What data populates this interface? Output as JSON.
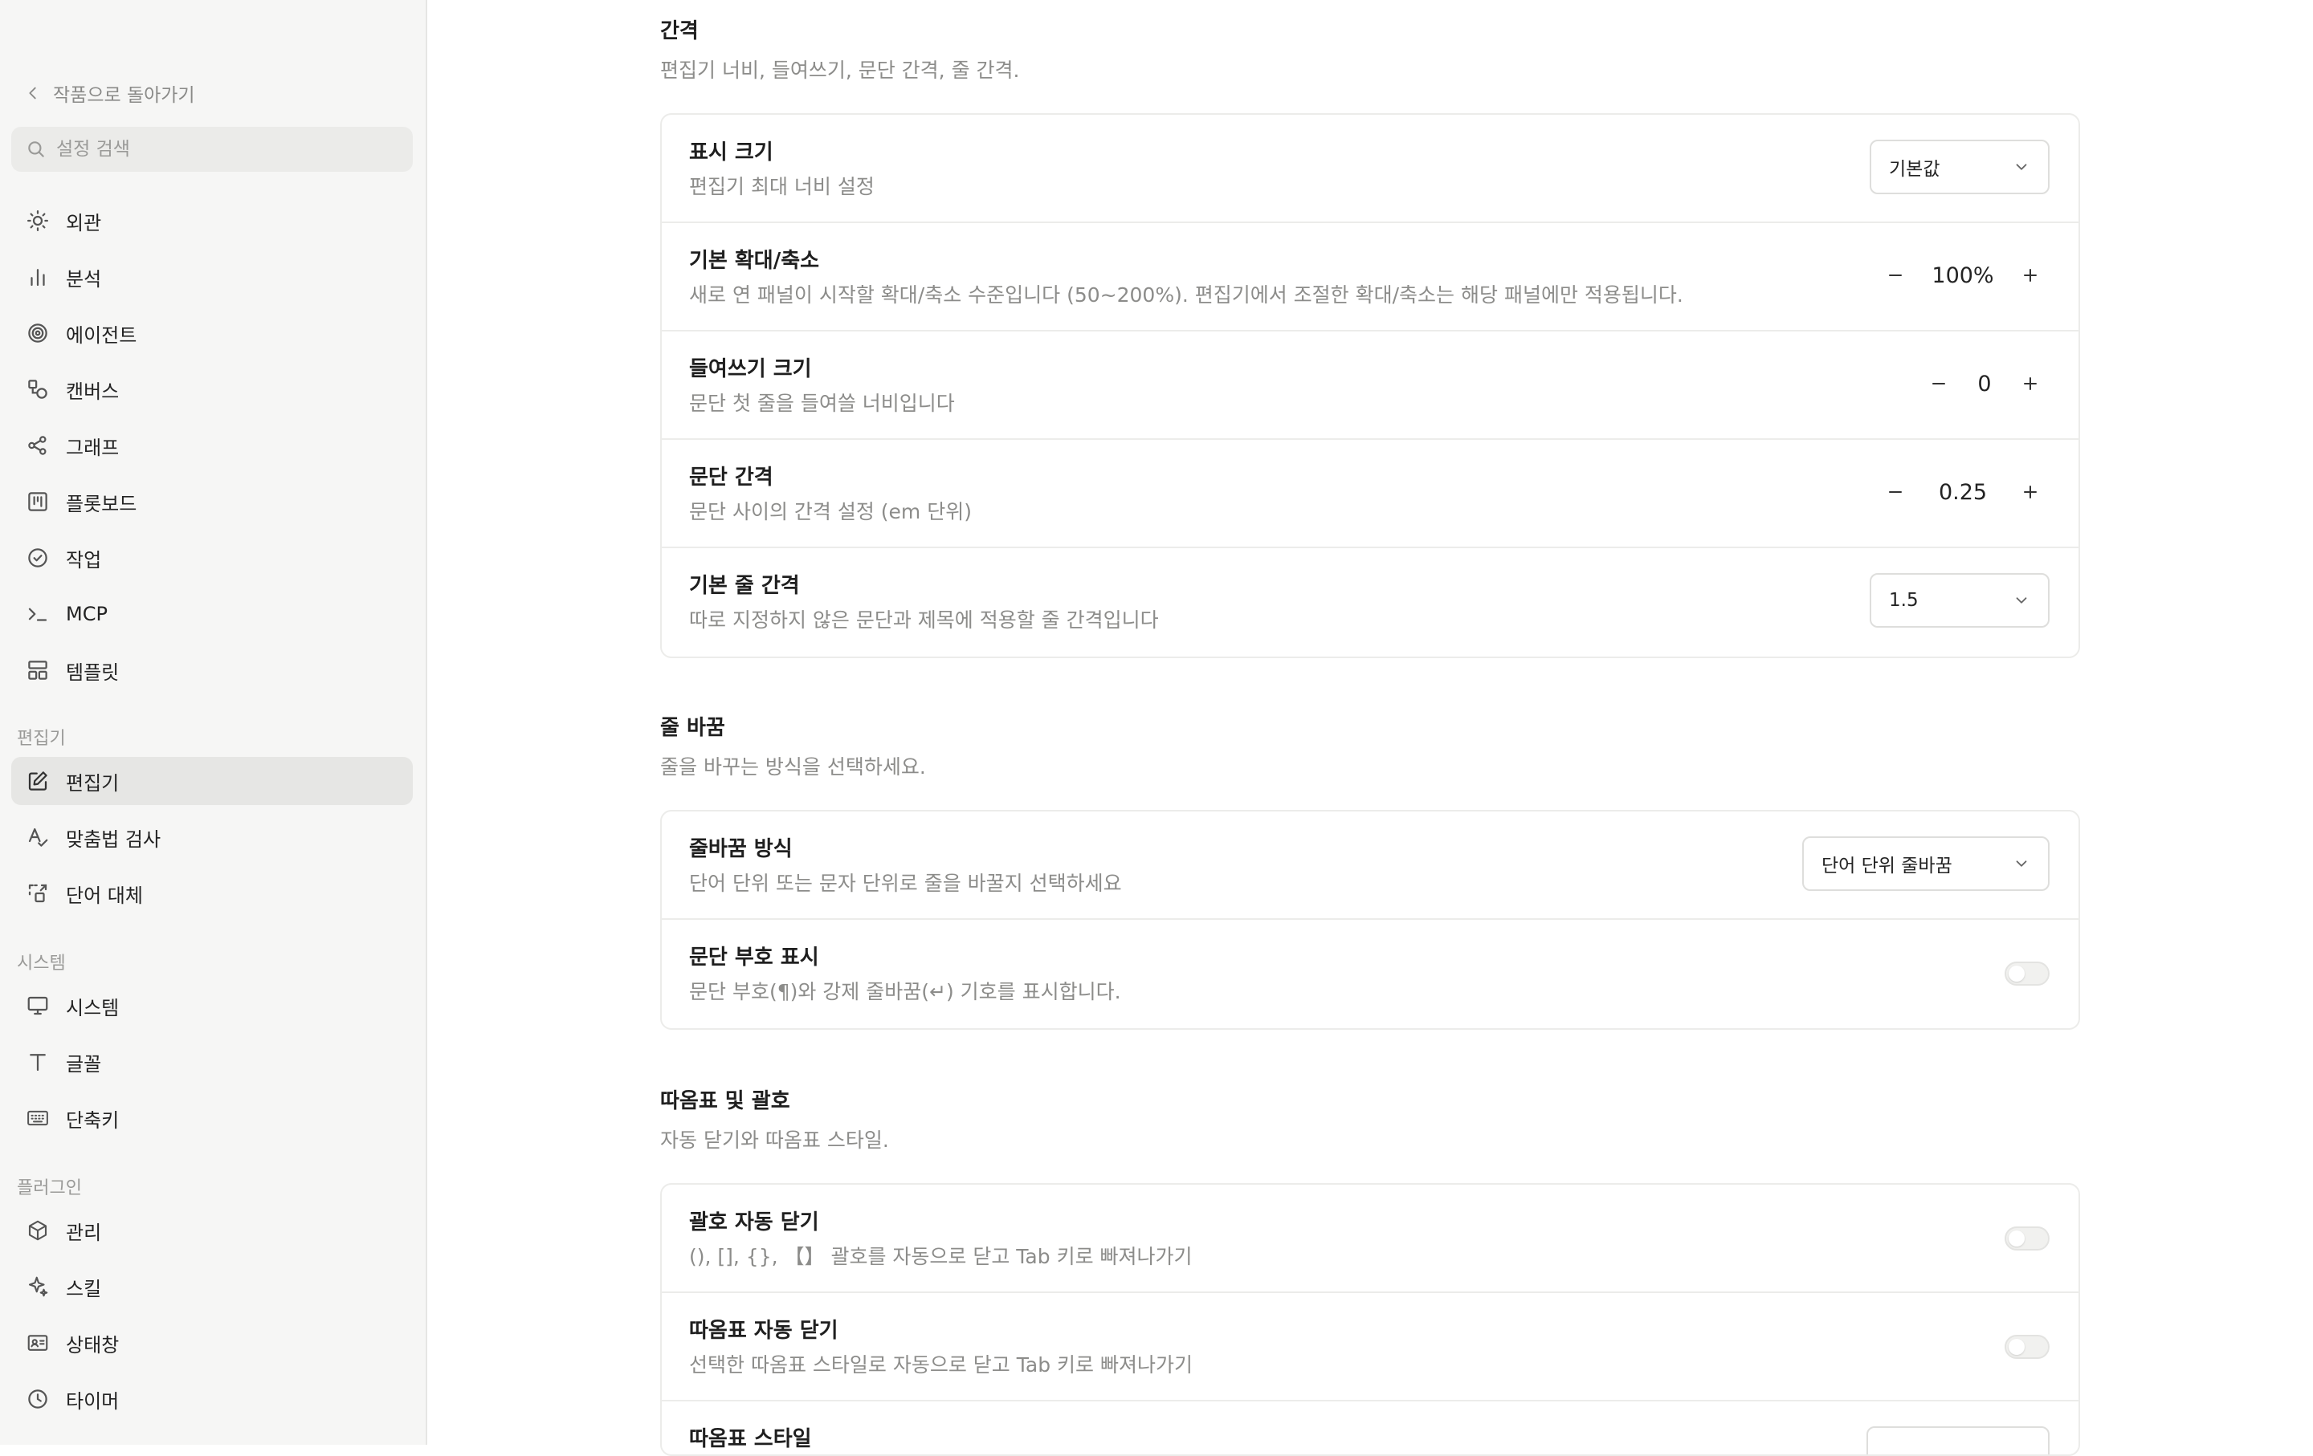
{
  "sidebar": {
    "back_label": "작품으로 돌아가기",
    "search_placeholder": "설정 검색",
    "items": [
      {
        "label": "외관"
      },
      {
        "label": "분석"
      },
      {
        "label": "에이전트"
      },
      {
        "label": "캔버스"
      },
      {
        "label": "그래프"
      },
      {
        "label": "플롯보드"
      },
      {
        "label": "작업"
      },
      {
        "label": "MCP"
      },
      {
        "label": "템플릿"
      }
    ],
    "editor_section": {
      "label": "편집기",
      "items": [
        {
          "label": "편집기"
        },
        {
          "label": "맞춤법 검사"
        },
        {
          "label": "단어 대체"
        }
      ]
    },
    "system_section": {
      "label": "시스템",
      "items": [
        {
          "label": "시스템"
        },
        {
          "label": "글꼴"
        },
        {
          "label": "단축키"
        }
      ]
    },
    "plugin_section": {
      "label": "플러그인",
      "items": [
        {
          "label": "관리"
        },
        {
          "label": "스킬"
        },
        {
          "label": "상태창"
        },
        {
          "label": "타이머"
        }
      ]
    }
  },
  "spacing": {
    "title": "간격",
    "desc": "편집기 너비, 들여쓰기, 문단 간격, 줄 간격.",
    "display_size": {
      "title": "표시 크기",
      "desc": "편집기 최대 너비 설정",
      "value": "기본값"
    },
    "zoom": {
      "title": "기본 확대/축소",
      "desc": "새로 연 패널이 시작할 확대/축소 수준입니다 (50~200%). 편집기에서 조절한 확대/축소는 해당 패널에만 적용됩니다.",
      "value": "100%"
    },
    "indent": {
      "title": "들여쓰기 크기",
      "desc": "문단 첫 줄을 들여쓸 너비입니다",
      "value": "0"
    },
    "paragraph": {
      "title": "문단 간격",
      "desc": "문단 사이의 간격 설정 (em 단위)",
      "value": "0.25"
    },
    "line": {
      "title": "기본 줄 간격",
      "desc": "따로 지정하지 않은 문단과 제목에 적용할 줄 간격입니다",
      "value": "1.5"
    }
  },
  "wrap": {
    "title": "줄 바꿈",
    "desc": "줄을 바꾸는 방식을 선택하세요.",
    "mode": {
      "title": "줄바꿈 방식",
      "desc": "단어 단위 또는 문자 단위로 줄을 바꿀지 선택하세요",
      "value": "단어 단위 줄바꿈"
    },
    "marks": {
      "title": "문단 부호 표시",
      "desc": "문단 부호(¶)와 강제 줄바꿈(↵) 기호를 표시합니다.",
      "on": false
    }
  },
  "quotes": {
    "title": "따옴표 및 괄호",
    "desc": "자동 닫기와 따옴표 스타일.",
    "brackets": {
      "title": "괄호 자동 닫기",
      "desc": "(), [], {}, 【】 괄호를 자동으로 닫고 Tab 키로 빠져나가기",
      "on": false
    },
    "quote_close": {
      "title": "따옴표 자동 닫기",
      "desc": "선택한 따옴표 스타일로 자동으로 닫고 Tab 키로 빠져나가기",
      "on": false
    },
    "style": {
      "title": "따옴표 스타일"
    }
  }
}
